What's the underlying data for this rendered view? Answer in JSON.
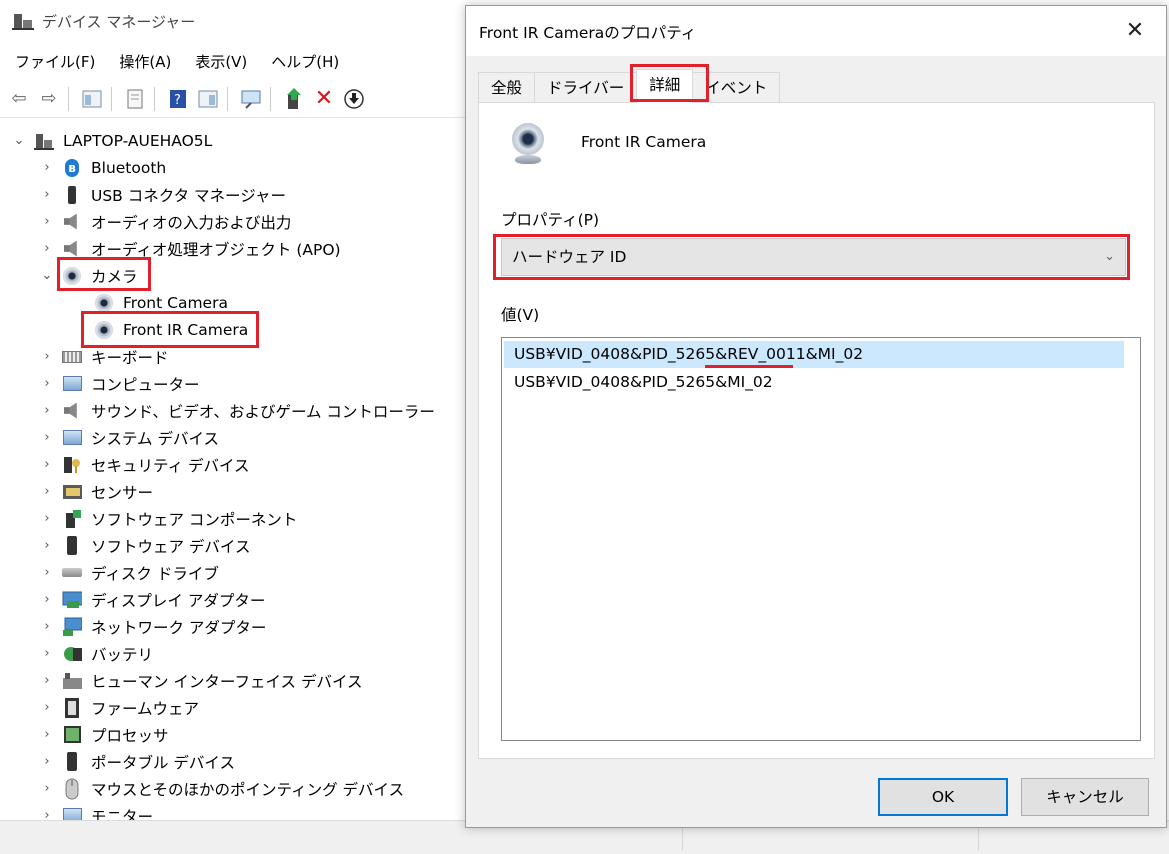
{
  "main_window": {
    "title": "デバイス マネージャー",
    "menu": [
      "ファイル(F)",
      "操作(A)",
      "表示(V)",
      "ヘルプ(H)"
    ],
    "root_node": "LAPTOP-AUEHAO5L",
    "categories": [
      {
        "label": "Bluetooth",
        "icon": "bluetooth-icon"
      },
      {
        "label": "USB コネクタ マネージャー",
        "icon": "usb-icon"
      },
      {
        "label": "オーディオの入力および出力",
        "icon": "speaker-icon"
      },
      {
        "label": "オーディオ処理オブジェクト (APO)",
        "icon": "speaker-icon"
      },
      {
        "label": "カメラ",
        "icon": "camera-icon"
      },
      {
        "label": "Front Camera",
        "icon": "camera-icon"
      },
      {
        "label": "Front IR Camera",
        "icon": "camera-icon"
      },
      {
        "label": "キーボード",
        "icon": "keyboard-icon"
      },
      {
        "label": "コンピューター",
        "icon": "monitor-icon"
      },
      {
        "label": "サウンド、ビデオ、およびゲーム コントローラー",
        "icon": "speaker-icon"
      },
      {
        "label": "システム デバイス",
        "icon": "folder-icon"
      },
      {
        "label": "セキュリティ デバイス",
        "icon": "key-icon"
      },
      {
        "label": "センサー",
        "icon": "sensor-icon"
      },
      {
        "label": "ソフトウェア コンポーネント",
        "icon": "component-icon"
      },
      {
        "label": "ソフトウェア デバイス",
        "icon": "device-icon"
      },
      {
        "label": "ディスク ドライブ",
        "icon": "drive-icon"
      },
      {
        "label": "ディスプレイ アダプター",
        "icon": "display-adapter-icon"
      },
      {
        "label": "ネットワーク アダプター",
        "icon": "network-icon"
      },
      {
        "label": "バッテリ",
        "icon": "battery-icon"
      },
      {
        "label": "ヒューマン インターフェイス デバイス",
        "icon": "hid-icon"
      },
      {
        "label": "ファームウェア",
        "icon": "firmware-icon"
      },
      {
        "label": "プロセッサ",
        "icon": "chip-icon"
      },
      {
        "label": "ポータブル デバイス",
        "icon": "portable-icon"
      },
      {
        "label": "マウスとそのほかのポインティング デバイス",
        "icon": "mouse-icon"
      },
      {
        "label": "モニター",
        "icon": "monitor-icon"
      }
    ]
  },
  "dialog": {
    "title": "Front IR Cameraのプロパティ",
    "tabs": [
      "全般",
      "ドライバー",
      "詳細",
      "イベント"
    ],
    "device_name": "Front IR Camera",
    "property_label": "プロパティ(P)",
    "property_value": "ハードウェア ID",
    "value_label": "値(V)",
    "values": [
      "USB¥VID_0408&PID_5265&REV_0011&MI_02",
      "USB¥VID_0408&PID_5265&MI_02"
    ],
    "ok_label": "OK",
    "cancel_label": "キャンセル"
  }
}
